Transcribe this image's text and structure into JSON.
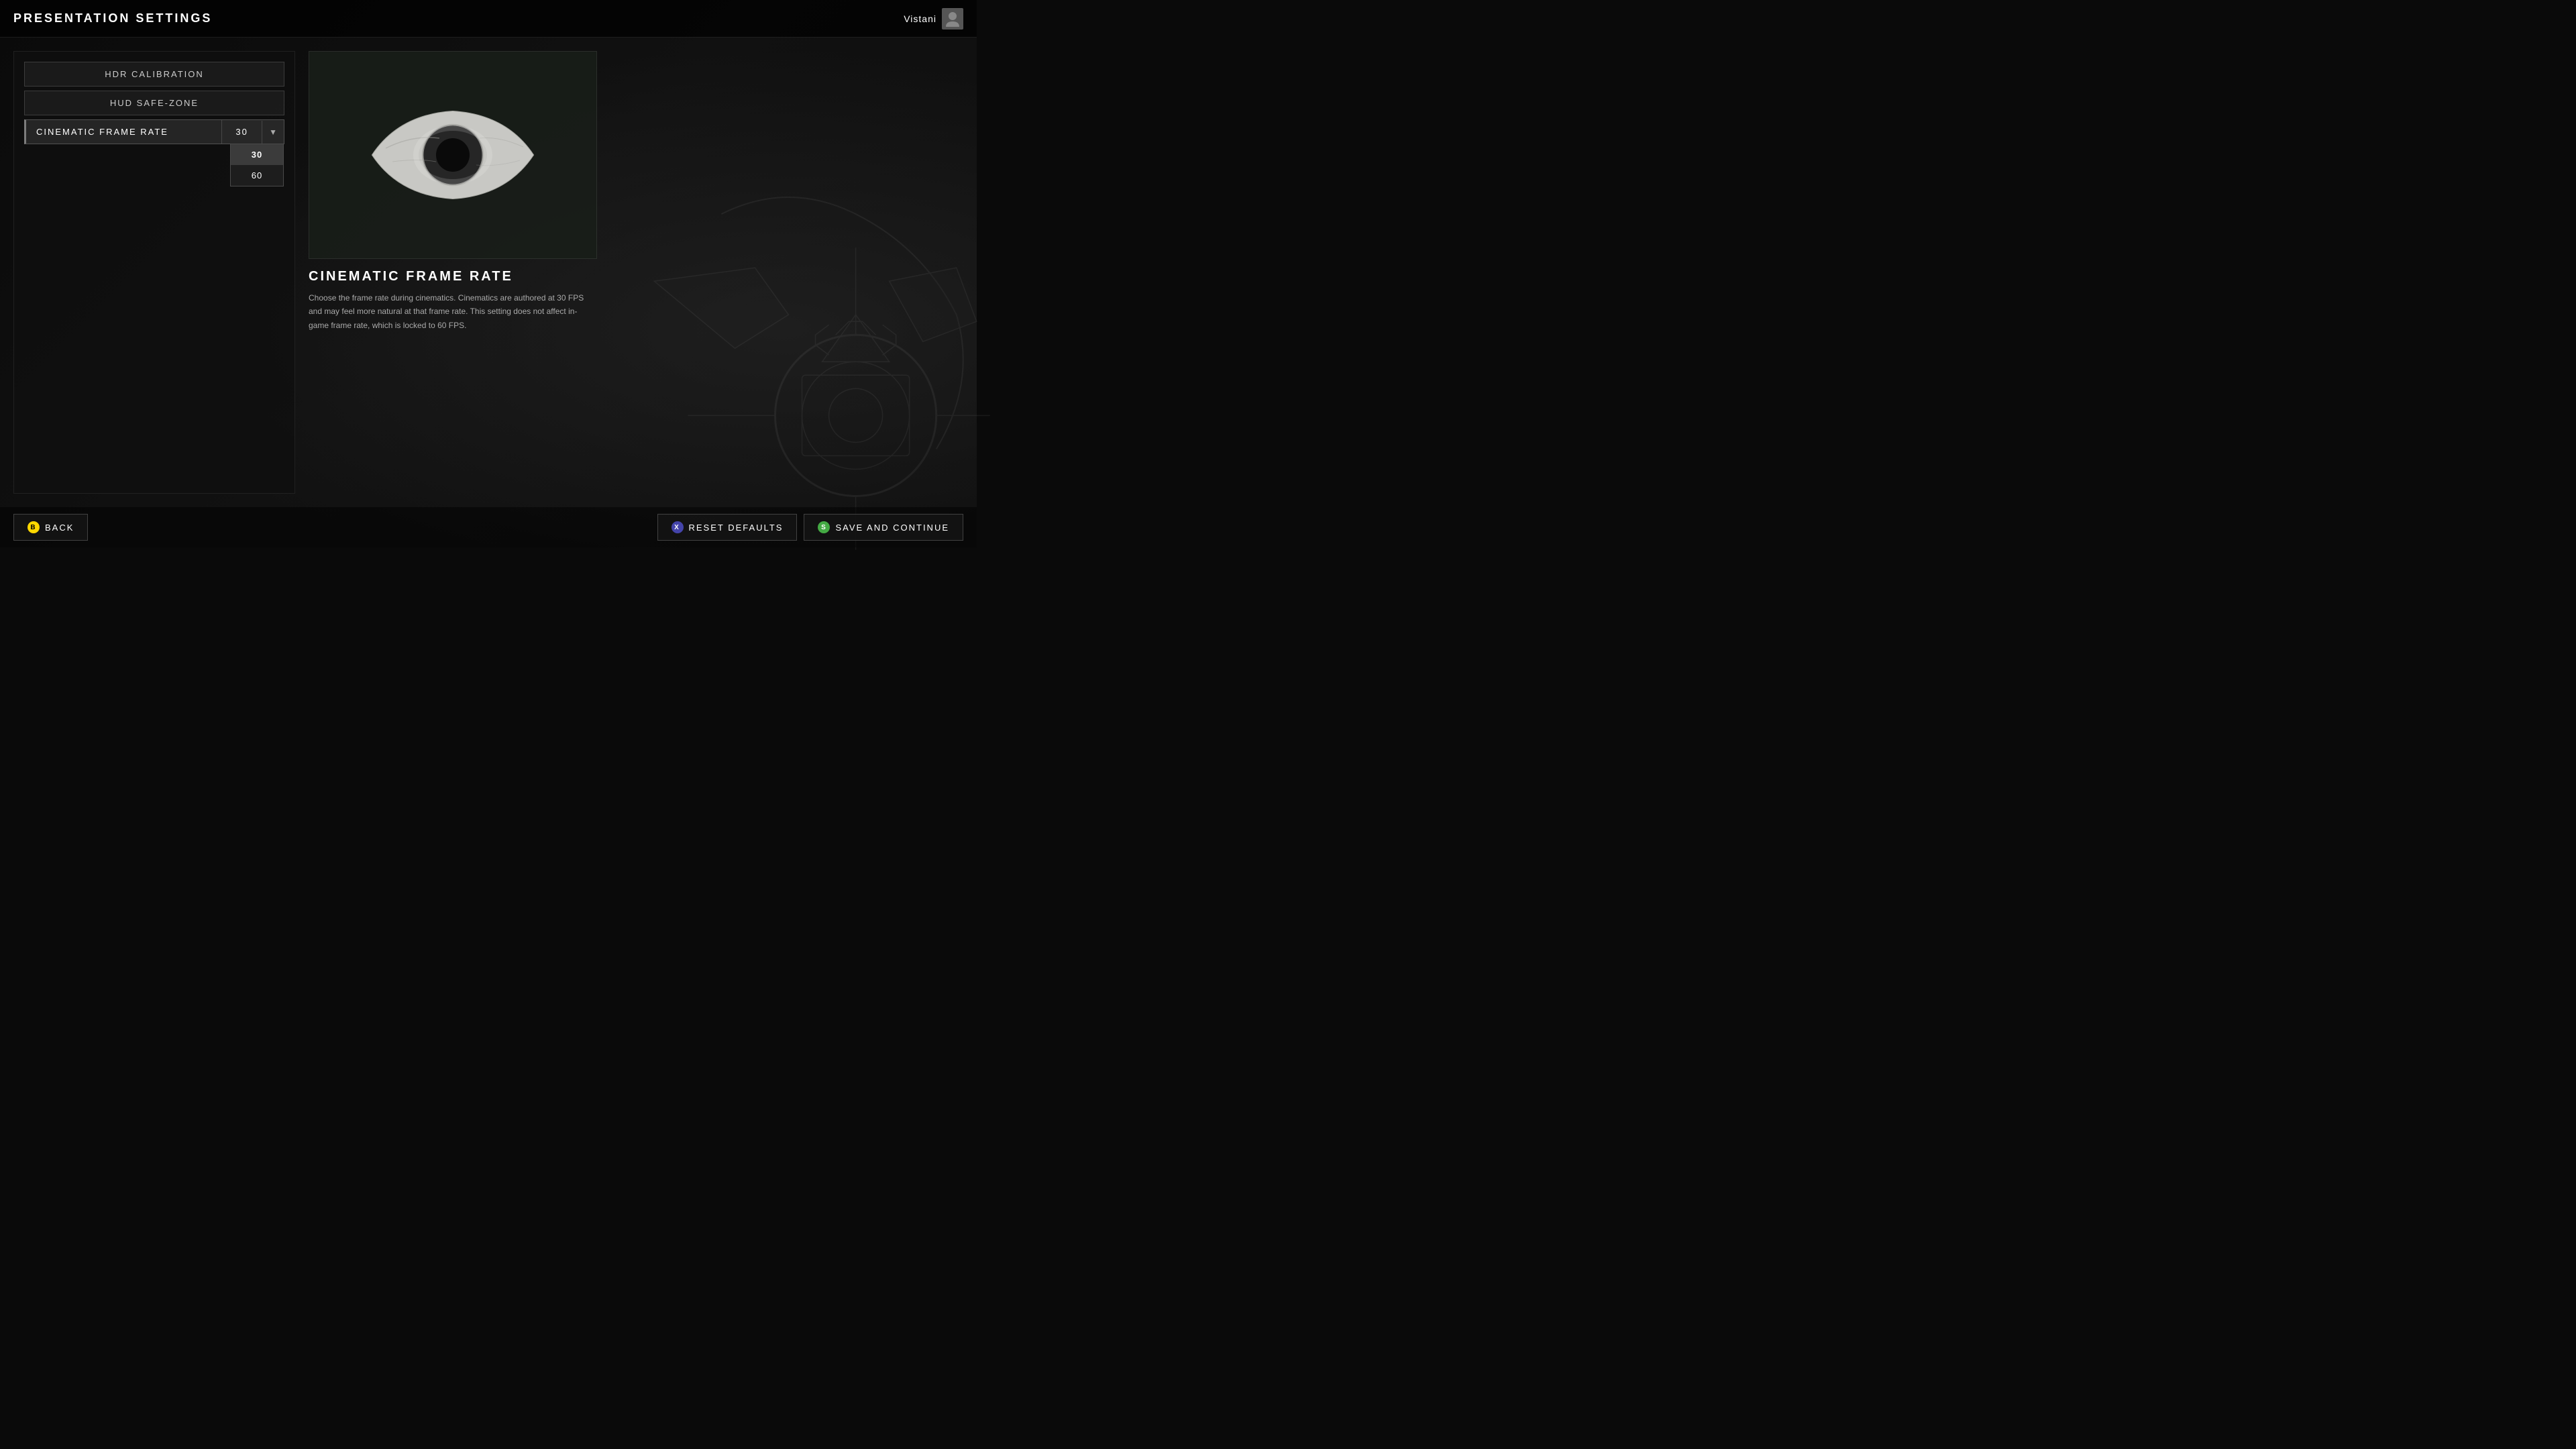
{
  "header": {
    "title": "PRESENTATION SETTINGS",
    "username": "Vistani"
  },
  "settings": {
    "items": [
      {
        "id": "hdr-calibration",
        "label": "HDR CALIBRATION",
        "active": false
      },
      {
        "id": "hud-safe-zone",
        "label": "HUD SAFE-ZONE",
        "active": false
      },
      {
        "id": "cinematic-frame-rate",
        "label": "CINEMATIC FRAME RATE",
        "active": true,
        "value": "30"
      }
    ],
    "dropdown": {
      "options": [
        "30",
        "60"
      ],
      "selected": "30"
    }
  },
  "detail": {
    "title": "CINEMATIC FRAME RATE",
    "description": "Choose the frame rate during cinematics. Cinematics are authored at 30 FPS and may feel more natural at that frame rate. This setting does not affect in-game frame rate, which is locked to 60 FPS."
  },
  "footer": {
    "back_label": "BACK",
    "back_icon": "B",
    "reset_label": "RESET DEFAULTS",
    "reset_icon": "X",
    "save_label": "SAVE AND CONTINUE",
    "save_icon": "S"
  }
}
